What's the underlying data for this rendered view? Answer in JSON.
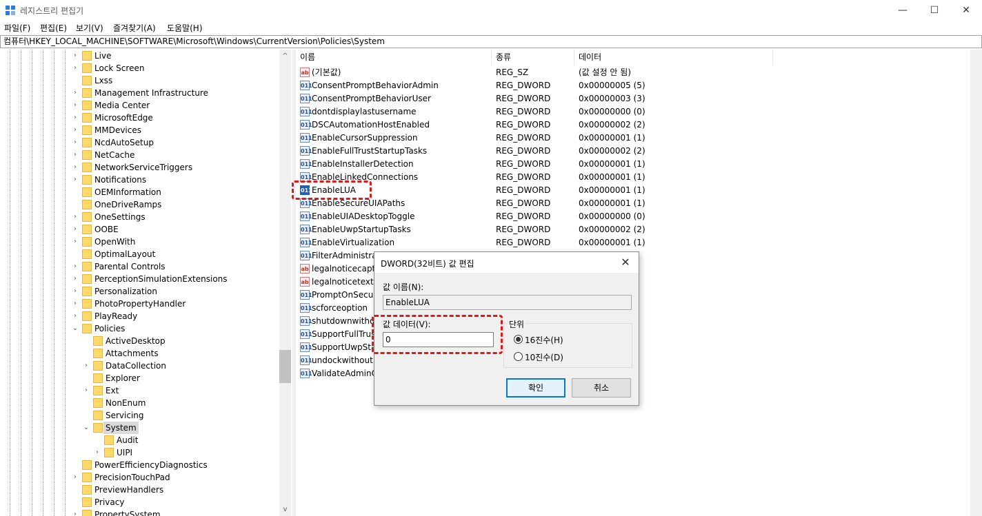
{
  "window": {
    "title": "레지스트리 편집기",
    "minimize": "—",
    "maximize": "☐",
    "close": "✕"
  },
  "menu": [
    "파일(F)",
    "편집(E)",
    "보기(V)",
    "즐겨찾기(A)",
    "도움말(H)"
  ],
  "address": "컴퓨터\\HKEY_LOCAL_MACHINE\\SOFTWARE\\Microsoft\\Windows\\CurrentVersion\\Policies\\System",
  "tree": [
    {
      "label": "Live",
      "chev": "›"
    },
    {
      "label": "Lock Screen",
      "chev": "›"
    },
    {
      "label": "Lxss",
      "chev": ""
    },
    {
      "label": "Management Infrastructure",
      "chev": "›"
    },
    {
      "label": "Media Center",
      "chev": "›"
    },
    {
      "label": "MicrosoftEdge",
      "chev": "›"
    },
    {
      "label": "MMDevices",
      "chev": "›"
    },
    {
      "label": "NcdAutoSetup",
      "chev": "›"
    },
    {
      "label": "NetCache",
      "chev": "›"
    },
    {
      "label": "NetworkServiceTriggers",
      "chev": "›"
    },
    {
      "label": "Notifications",
      "chev": "›"
    },
    {
      "label": "OEMInformation",
      "chev": ""
    },
    {
      "label": "OneDriveRamps",
      "chev": ""
    },
    {
      "label": "OneSettings",
      "chev": "›"
    },
    {
      "label": "OOBE",
      "chev": "›"
    },
    {
      "label": "OpenWith",
      "chev": "›"
    },
    {
      "label": "OptimalLayout",
      "chev": ""
    },
    {
      "label": "Parental Controls",
      "chev": "›"
    },
    {
      "label": "PerceptionSimulationExtensions",
      "chev": "›"
    },
    {
      "label": "Personalization",
      "chev": "›"
    },
    {
      "label": "PhotoPropertyHandler",
      "chev": "›"
    },
    {
      "label": "PlayReady",
      "chev": "›"
    },
    {
      "label": "Policies",
      "chev": "⌄"
    },
    {
      "label": "ActiveDesktop",
      "chev": ""
    },
    {
      "label": "Attachments",
      "chev": ""
    },
    {
      "label": "DataCollection",
      "chev": "›"
    },
    {
      "label": "Explorer",
      "chev": ""
    },
    {
      "label": "Ext",
      "chev": "›"
    },
    {
      "label": "NonEnum",
      "chev": ""
    },
    {
      "label": "Servicing",
      "chev": ""
    },
    {
      "label": "System",
      "chev": "⌄"
    },
    {
      "label": "Audit",
      "chev": ""
    },
    {
      "label": "UIPI",
      "chev": "›"
    },
    {
      "label": "PowerEfficiencyDiagnostics",
      "chev": ""
    },
    {
      "label": "PrecisionTouchPad",
      "chev": "›"
    },
    {
      "label": "PreviewHandlers",
      "chev": ""
    },
    {
      "label": "Privacy",
      "chev": ""
    },
    {
      "label": "PropertySystem",
      "chev": "›"
    }
  ],
  "scroll": {
    "up": "^",
    "down": "v"
  },
  "columns": {
    "name": "이름",
    "type": "종류",
    "data": "데이터"
  },
  "values": [
    {
      "name": "(기본값)",
      "type": "REG_SZ",
      "data": "(값 설정 안 됨)",
      "icon": "ab"
    },
    {
      "name": "ConsentPromptBehaviorAdmin",
      "type": "REG_DWORD",
      "data": "0x00000005 (5)",
      "icon": "011"
    },
    {
      "name": "ConsentPromptBehaviorUser",
      "type": "REG_DWORD",
      "data": "0x00000003 (3)",
      "icon": "011"
    },
    {
      "name": "dontdisplaylastusername",
      "type": "REG_DWORD",
      "data": "0x00000000 (0)",
      "icon": "011"
    },
    {
      "name": "DSCAutomationHostEnabled",
      "type": "REG_DWORD",
      "data": "0x00000002 (2)",
      "icon": "011"
    },
    {
      "name": "EnableCursorSuppression",
      "type": "REG_DWORD",
      "data": "0x00000001 (1)",
      "icon": "011"
    },
    {
      "name": "EnableFullTrustStartupTasks",
      "type": "REG_DWORD",
      "data": "0x00000002 (2)",
      "icon": "011"
    },
    {
      "name": "EnableInstallerDetection",
      "type": "REG_DWORD",
      "data": "0x00000001 (1)",
      "icon": "011"
    },
    {
      "name": "EnableLinkedConnections",
      "type": "REG_DWORD",
      "data": "0x00000001 (1)",
      "icon": "011"
    },
    {
      "name": "EnableLUA",
      "type": "REG_DWORD",
      "data": "0x00000001 (1)",
      "icon": "011"
    },
    {
      "name": "EnableSecureUIAPaths",
      "type": "REG_DWORD",
      "data": "0x00000001 (1)",
      "icon": "011"
    },
    {
      "name": "EnableUIADesktopToggle",
      "type": "REG_DWORD",
      "data": "0x00000000 (0)",
      "icon": "011"
    },
    {
      "name": "EnableUwpStartupTasks",
      "type": "REG_DWORD",
      "data": "0x00000002 (2)",
      "icon": "011"
    },
    {
      "name": "EnableVirtualization",
      "type": "REG_DWORD",
      "data": "0x00000001 (1)",
      "icon": "011"
    },
    {
      "name": "FilterAdministrato",
      "type": "",
      "data": "",
      "icon": "011"
    },
    {
      "name": "legalnoticecaptio",
      "type": "",
      "data": "",
      "icon": "ab"
    },
    {
      "name": "legalnoticetext",
      "type": "",
      "data": "",
      "icon": "ab"
    },
    {
      "name": "PromptOnSecure",
      "type": "",
      "data": "",
      "icon": "011"
    },
    {
      "name": "scforceoption",
      "type": "",
      "data": "",
      "icon": "011"
    },
    {
      "name": "shutdownwithou",
      "type": "",
      "data": "",
      "icon": "011"
    },
    {
      "name": "SupportFullTrust",
      "type": "",
      "data": "",
      "icon": "011"
    },
    {
      "name": "SupportUwpStar",
      "type": "",
      "data": "",
      "icon": "011"
    },
    {
      "name": "undockwithoutlo",
      "type": "",
      "data": "",
      "icon": "011"
    },
    {
      "name": "ValidateAdminCo",
      "type": "",
      "data": "",
      "icon": "011"
    }
  ],
  "dialog": {
    "title": "DWORD(32비트) 값 편집",
    "close": "✕",
    "name_label": "값 이름(N):",
    "name_value": "EnableLUA",
    "data_label": "값 데이터(V):",
    "data_value": "0",
    "base_label": "단위",
    "hex_label": "16진수(H)",
    "dec_label": "10진수(D)",
    "ok_label": "확인",
    "cancel_label": "취소"
  },
  "colors": {
    "highlight": "#e01818",
    "accent": "#0078d7"
  }
}
